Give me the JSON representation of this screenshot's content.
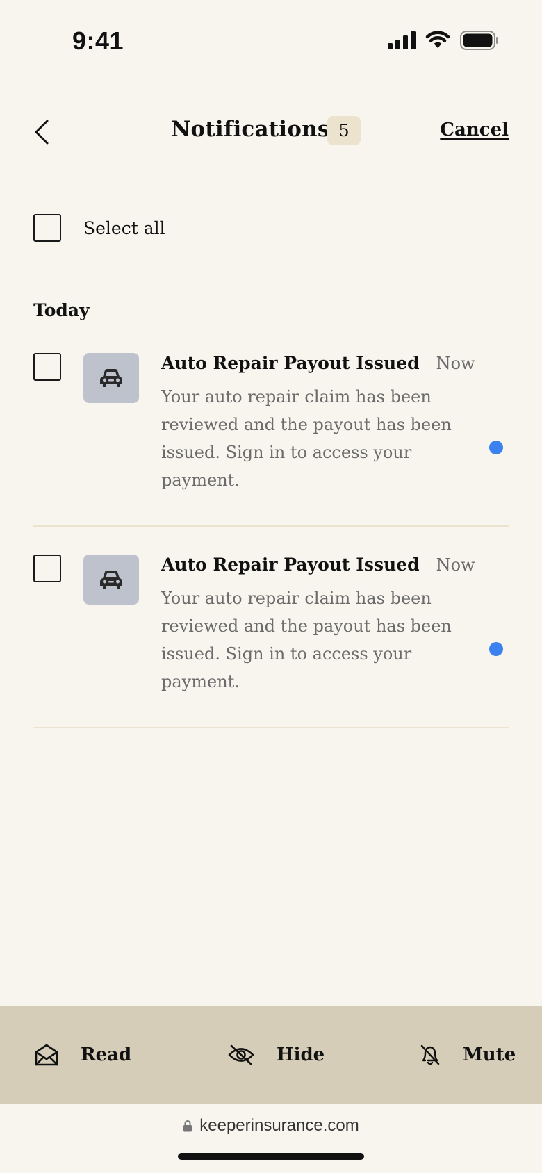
{
  "status_bar": {
    "time": "9:41"
  },
  "header": {
    "title": "Notifications",
    "count": "5",
    "cancel_label": "Cancel"
  },
  "select_all": {
    "label": "Select all"
  },
  "sections": [
    {
      "title": "Today",
      "items": [
        {
          "icon": "car-icon",
          "title": "Auto Repair Payout Issued",
          "time": "Now",
          "body": "Your auto repair claim has been reviewed and the payout has been issued. Sign in to access your payment.",
          "unread": true
        },
        {
          "icon": "car-icon",
          "title": "Auto Repair Payout Issued",
          "time": "Now",
          "body": "Your auto repair claim has been reviewed and the payout has been issued. Sign in to access your payment.",
          "unread": true
        }
      ]
    }
  ],
  "actions": {
    "read": "Read",
    "hide": "Hide",
    "mute": "Mute"
  },
  "browser": {
    "url": "keeperinsurance.com"
  },
  "colors": {
    "background": "#f7f5ee",
    "action_bar": "#d6cdb8",
    "badge": "#ece3cf",
    "unread": "#3b82f0",
    "thumb": "#bec2cd"
  }
}
